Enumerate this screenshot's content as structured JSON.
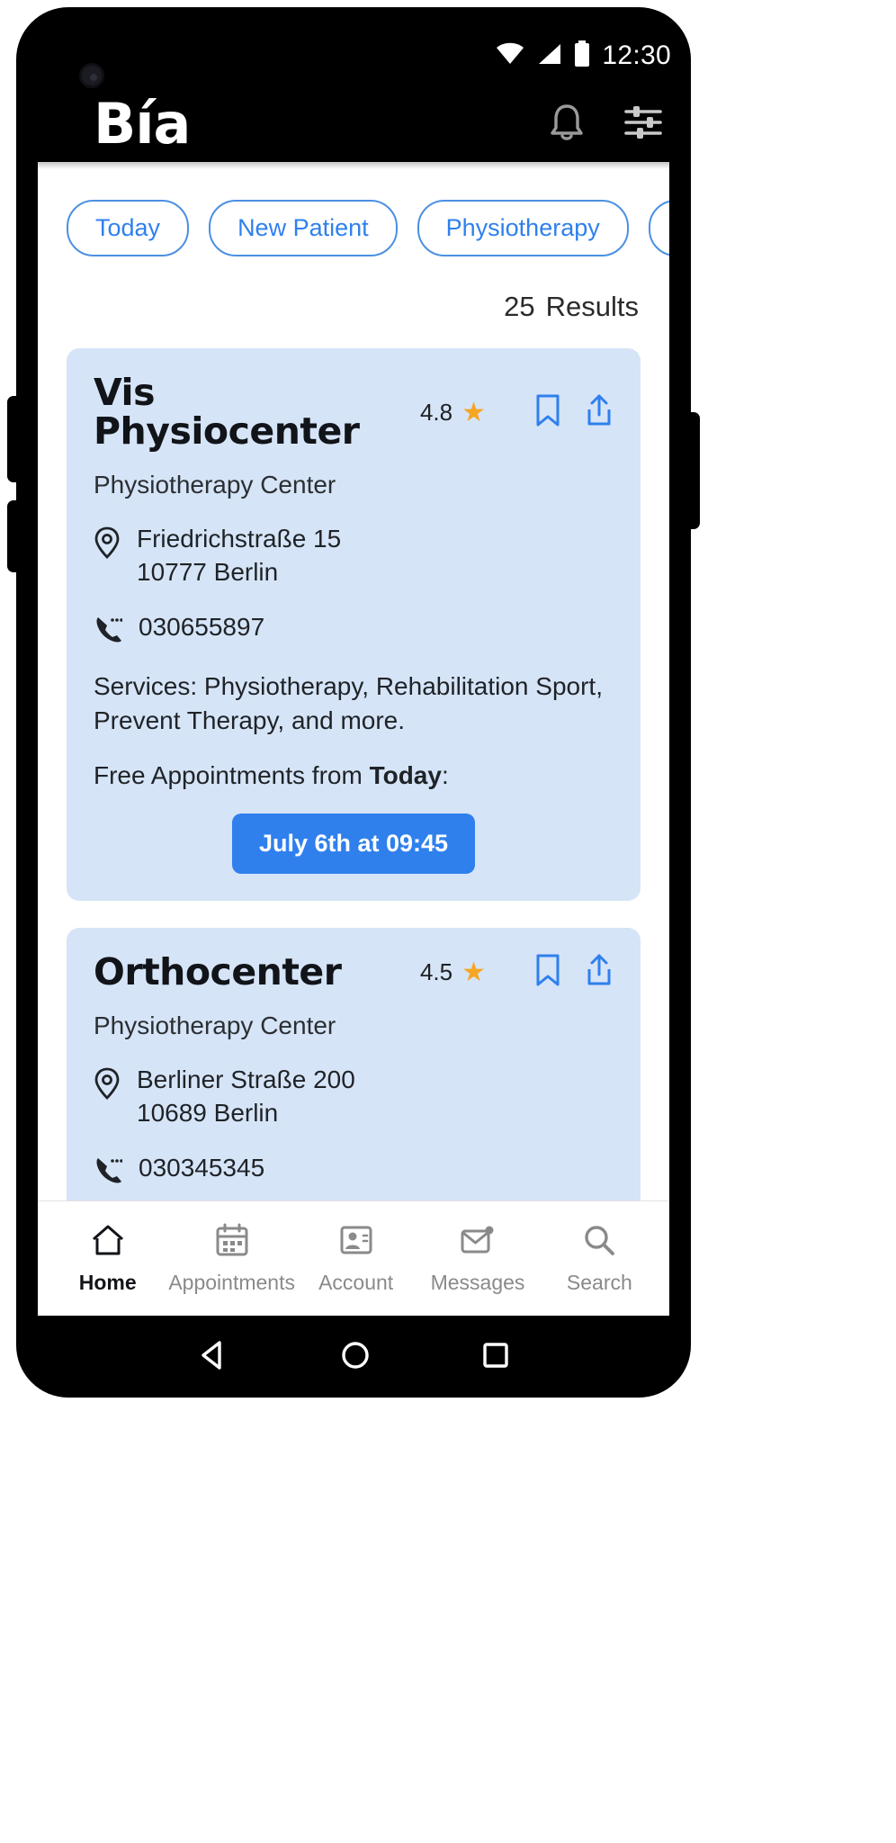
{
  "status_bar": {
    "clock": "12:30",
    "icons": [
      "wifi-icon",
      "cellular-signal-icon",
      "battery-icon"
    ]
  },
  "header": {
    "logo": "Bía",
    "notification_icon": "bell-icon",
    "filter_icon": "filter-sliders-icon"
  },
  "filters": {
    "chips": [
      {
        "label": "Today"
      },
      {
        "label": "New Patient"
      },
      {
        "label": "Physiotherapy"
      },
      {
        "label": ""
      }
    ]
  },
  "results": {
    "count": "25",
    "label": "Results"
  },
  "cards": [
    {
      "title": "Vis Physiocenter",
      "rating": "4.8",
      "star_icon": "star-icon",
      "bookmark_icon": "bookmark-icon",
      "share_icon": "share-icon",
      "subtitle": "Physiotherapy Center",
      "location_icon": "location-pin-icon",
      "address_line1": "Friedrichstraße 15",
      "address_line2": "10777 Berlin",
      "phone_icon": "phone-ringing-icon",
      "phone": "030655897",
      "services": "Services: Physiotherapy, Rehabilitation Sport, Prevent Therapy, and more.",
      "free_prefix": "Free Appointments from ",
      "free_bold": "Today",
      "free_suffix": ":",
      "appointment_button": "July 6th at 09:45"
    },
    {
      "title": "Orthocenter",
      "rating": "4.5",
      "star_icon": "star-icon",
      "bookmark_icon": "bookmark-icon",
      "share_icon": "share-icon",
      "subtitle": "Physiotherapy Center",
      "location_icon": "location-pin-icon",
      "address_line1": "Berliner Straße 200",
      "address_line2": "10689 Berlin",
      "phone_icon": "phone-ringing-icon",
      "phone": "030345345"
    }
  ],
  "bottom_nav": [
    {
      "label": "Home",
      "icon": "home-icon",
      "active": true
    },
    {
      "label": "Appointments",
      "icon": "calendar-icon",
      "active": false
    },
    {
      "label": "Account",
      "icon": "account-card-icon",
      "active": false
    },
    {
      "label": "Messages",
      "icon": "mail-badge-icon",
      "active": false
    },
    {
      "label": "Search",
      "icon": "search-icon",
      "active": false
    }
  ],
  "system_bar": {
    "back_icon": "android-back-triangle-icon",
    "home_icon": "android-home-circle-icon",
    "recents_icon": "android-recents-square-icon"
  },
  "colors": {
    "accent_blue": "#2f80ed",
    "chip_border": "#4a90e2",
    "card_bg": "#d6e4f7",
    "star_gold": "#f5a623"
  }
}
